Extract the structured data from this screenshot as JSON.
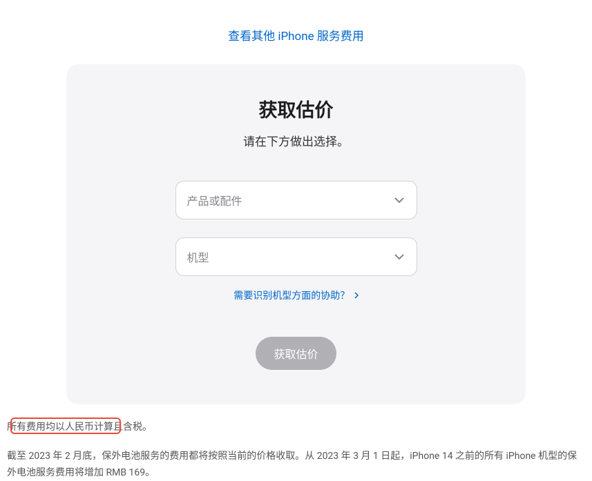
{
  "top_link": {
    "text": "查看其他 iPhone 服务费用"
  },
  "card": {
    "title": "获取估价",
    "subtitle": "请在下方做出选择。",
    "select1_placeholder": "产品或配件",
    "select2_placeholder": "机型",
    "help_text": "需要识别机型方面的协助？",
    "button_label": "获取估价"
  },
  "footer": {
    "p1": "所有费用均以人民币计算且含税。",
    "p2": "截至 2023 年 2 月底，保外电池服务的费用都将按照当前的价格收取。从 2023 年 3 月 1 日起，iPhone 14 之前的所有 iPhone 机型的保外电池服务费用将增加 RMB 169。"
  }
}
